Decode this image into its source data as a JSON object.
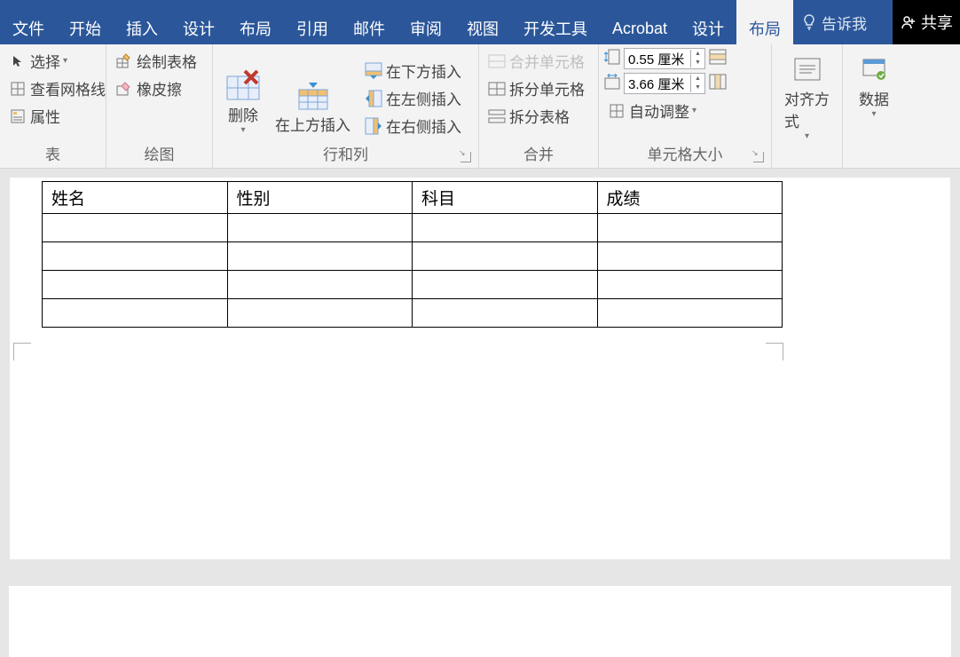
{
  "tabs": {
    "file": "文件",
    "home": "开始",
    "insert": "插入",
    "design_main": "设计",
    "layout_main": "布局",
    "references": "引用",
    "mailings": "邮件",
    "review": "审阅",
    "view": "视图",
    "developer": "开发工具",
    "acrobat": "Acrobat",
    "table_design": "设计",
    "table_layout": "布局"
  },
  "tell_me": "告诉我",
  "share": "共享",
  "ribbon": {
    "table_group": {
      "label": "表",
      "select": "选择",
      "view_gridlines": "查看网格线",
      "properties": "属性"
    },
    "draw_group": {
      "label": "绘图",
      "draw_table": "绘制表格",
      "eraser": "橡皮擦"
    },
    "rows_cols_group": {
      "label": "行和列",
      "delete": "删除",
      "insert_above": "在上方插入",
      "insert_below": "在下方插入",
      "insert_left": "在左侧插入",
      "insert_right": "在右侧插入"
    },
    "merge_group": {
      "label": "合并",
      "merge_cells": "合并单元格",
      "split_cells": "拆分单元格",
      "split_table": "拆分表格"
    },
    "cell_size_group": {
      "label": "单元格大小",
      "height_value": "0.55 厘米",
      "width_value": "3.66 厘米",
      "autofit": "自动调整"
    },
    "alignment_group": {
      "label": "对齐方式"
    },
    "data_group": {
      "label": "数据"
    }
  },
  "doc_table": {
    "headers": [
      "姓名",
      "性别",
      "科目",
      "成绩"
    ],
    "rows": [
      [
        "",
        "",
        "",
        ""
      ],
      [
        "",
        "",
        "",
        ""
      ],
      [
        "",
        "",
        "",
        ""
      ],
      [
        "",
        "",
        "",
        ""
      ]
    ]
  }
}
